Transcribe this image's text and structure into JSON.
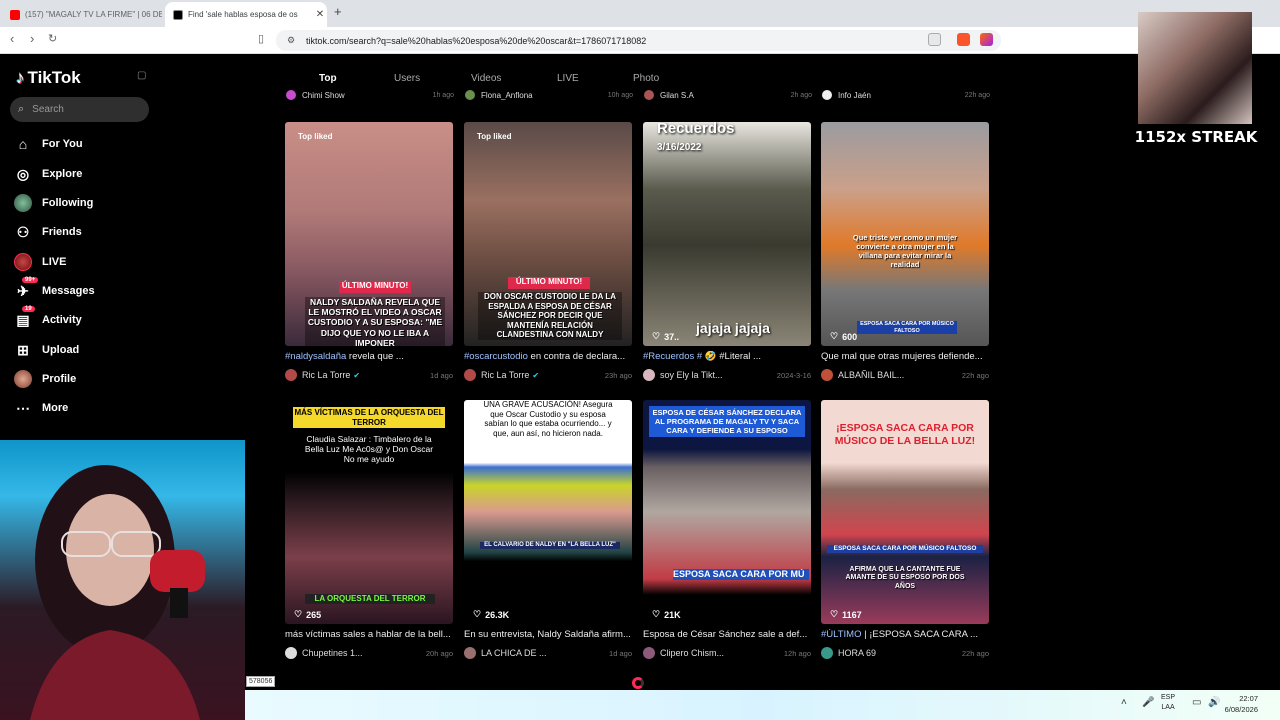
{
  "browser": {
    "tabs": [
      {
        "title": "(157) \"MAGALY TV LA FIRME\" | 06 DE",
        "active": false
      },
      {
        "title": "Find 'sale hablas esposa de os",
        "active": true
      }
    ],
    "url": "tiktok.com/search?q=sale%20hablas%20esposa%20de%20oscar&t=1786071718082"
  },
  "sidebar": {
    "logo": "TikTok",
    "search_placeholder": "Search",
    "items": [
      {
        "label": "For You",
        "icon": "home-icon"
      },
      {
        "label": "Explore",
        "icon": "compass-icon"
      },
      {
        "label": "Following",
        "icon": "following-avatar-icon"
      },
      {
        "label": "Friends",
        "icon": "friends-icon"
      },
      {
        "label": "LIVE",
        "icon": "live-icon"
      },
      {
        "label": "Messages",
        "icon": "messages-icon",
        "badge": "99+"
      },
      {
        "label": "Activity",
        "icon": "activity-icon",
        "badge": "19"
      },
      {
        "label": "Upload",
        "icon": "upload-icon"
      },
      {
        "label": "Profile",
        "icon": "profile-avatar-icon"
      },
      {
        "label": "More",
        "icon": "more-icon"
      }
    ]
  },
  "search_tabs": [
    "Top",
    "Users",
    "Videos",
    "LIVE",
    "Photo"
  ],
  "previous_row": [
    {
      "author": "Chimi Show",
      "time": "1h ago"
    },
    {
      "author": "Flona_Anflona",
      "time": "10h ago"
    },
    {
      "author": "Gilan S.A",
      "time": "2h ago"
    },
    {
      "author": "Info Jaén",
      "time": "22h ago"
    }
  ],
  "results": [
    {
      "top_liked": "Top liked",
      "overlay": "NALDY SALDAÑA REVELA QUE LE MOSTRÓ EL VIDEO A OSCAR CUSTODIO Y A SU ESPOSA: \"ME DIJO QUE YO NO LE IBA A IMPONER",
      "banner": "ÚLTIMO MINUTO!",
      "likes": "",
      "desc_tag": "#naldysaldaña",
      "desc": " revela que ...",
      "author": "Ric La Torre",
      "verified": true,
      "time": "1d ago"
    },
    {
      "top_liked": "Top liked",
      "overlay": "DON OSCAR CUSTODIO LE DA LA ESPALDA A ESPOSA DE CÉSAR SÁNCHEZ POR DECIR QUE MANTENÍA RELACIÓN CLANDESTINA CON NALDY",
      "banner": "ÚLTIMO MINUTO!",
      "likes": "",
      "desc_tag": "#oscarcustodio",
      "desc": " en contra de declara...",
      "author": "Ric La Torre",
      "verified": true,
      "time": "23h ago"
    },
    {
      "top_liked": "",
      "overlay": "Recuerdos",
      "overlay2": "3/16/2022",
      "overlay3": "jajaja jajaja",
      "likes": "37..",
      "desc_tag": "#Recuerdos # ",
      "desc": "🤣 #Literal ...",
      "author": "soy Ely la Tikt...",
      "verified": false,
      "time": "2024-3-16"
    },
    {
      "top_liked": "",
      "overlay": "Que triste ver como un mujer convierte a otra mujer en la villana para evitar mirar la realidad",
      "banner": "ESPOSA SACA CARA POR MÚSICO FALTOSO",
      "likes": "600",
      "desc_tag": "",
      "desc": "Que mal que otras mujeres defiende...",
      "author": "ALBAÑIL BAIL...",
      "verified": false,
      "time": "22h ago"
    },
    {
      "top_liked": "",
      "overlay": "MÁS VÍCTIMAS DE LA ORQUESTA DEL TERROR",
      "overlay2": "Claudia Salazar : Timbalero de la Bella Luz Me Ac0s@ y Don Oscar No me ayudo",
      "banner": "LA ORQUESTA DEL TERROR",
      "likes": "265",
      "desc_tag": "",
      "desc": "más víctimas sales a hablar de la bell...",
      "author": "Chupetines 1...",
      "verified": false,
      "time": "20h ago"
    },
    {
      "top_liked": "",
      "overlay": "UNA GRAVE ACUSACIÓN! Asegura que Oscar Custodio y su esposa sabían lo que estaba ocurriendo... y que, aun así, no hicieron nada.",
      "banner": "EL CALVARIO DE NALDY EN \"LA BELLA LUZ\"",
      "likes": "26.3K",
      "desc_tag": "",
      "desc": "En su entrevista, Naldy Saldaña afirm...",
      "author": "LA CHICA DE ...",
      "verified": false,
      "time": "1d ago"
    },
    {
      "top_liked": "",
      "overlay": "ESPOSA DE CÉSAR SÁNCHEZ DECLARA AL PROGRAMA DE MAGALY TV Y SACA CARA Y DEFIENDE A SU ESPOSO",
      "banner": "ESPOSA SACA CARA POR MÚ",
      "likes": "21K",
      "desc_tag": "",
      "desc": "Esposa de César Sánchez sale a def...",
      "author": "Clipero Chism...",
      "verified": false,
      "time": "12h ago"
    },
    {
      "top_liked": "",
      "overlay": "¡ESPOSA SACA CARA POR MÚSICO DE LA BELLA LUZ!",
      "overlay2": "AFIRMA QUE LA CANTANTE FUE AMANTE DE SU ESPOSO POR DOS AÑOS",
      "banner": "ESPOSA SACA CARA POR MÚSICO FALTOSO",
      "likes": "1167",
      "desc_tag": "#ÚLTIMO",
      "desc": " | ¡ESPOSA SACA CARA ...",
      "author": "HORA 69",
      "verified": false,
      "time": "22h ago"
    }
  ],
  "overlays": {
    "streak": "1152x STREAK",
    "task_number": "578056"
  },
  "system_tray": {
    "lang": "ESP",
    "lang2": "LAA",
    "time": "22:07",
    "date": "6/08/2026"
  }
}
